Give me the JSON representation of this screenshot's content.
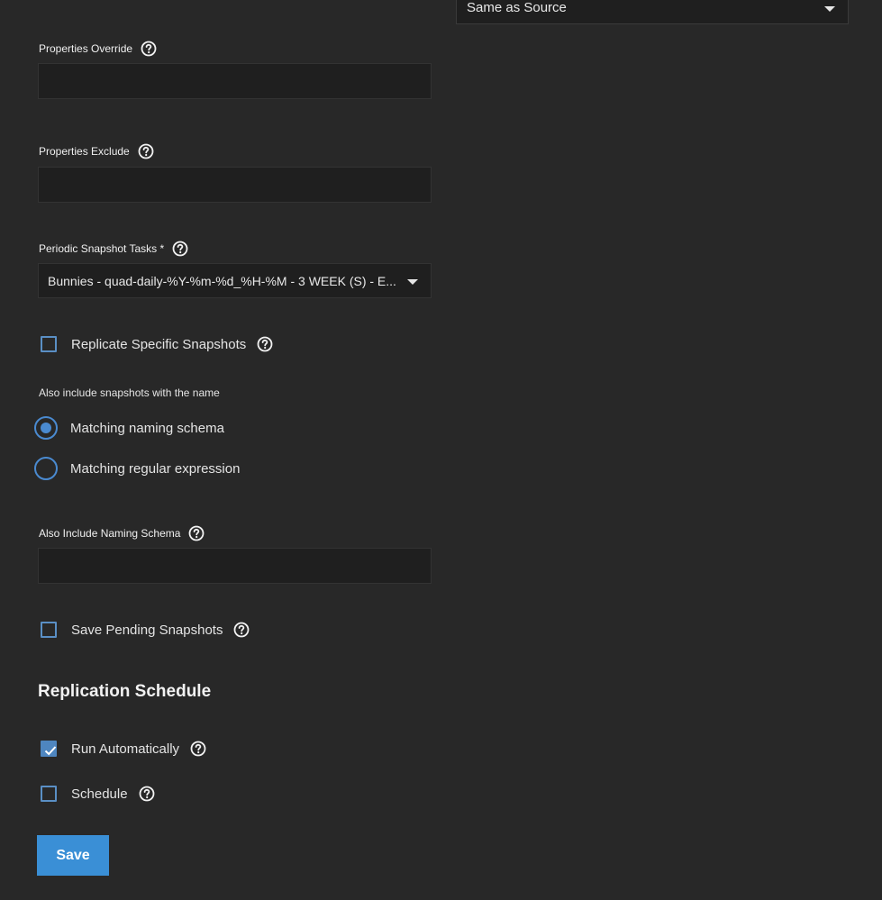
{
  "top_select": {
    "value": "Same as Source"
  },
  "properties_override": {
    "label": "Properties Override",
    "value": ""
  },
  "properties_exclude": {
    "label": "Properties Exclude",
    "value": ""
  },
  "periodic_snapshot_tasks": {
    "label": "Periodic Snapshot Tasks *",
    "value": "Bunnies - quad-daily-%Y-%m-%d_%H-%M - 3 WEEK (S) - E..."
  },
  "replicate_specific_snapshots": {
    "label": "Replicate Specific Snapshots",
    "checked": false
  },
  "also_include": {
    "label": "Also include snapshots with the name",
    "options": [
      {
        "label": "Matching naming schema",
        "selected": true
      },
      {
        "label": "Matching regular expression",
        "selected": false
      }
    ]
  },
  "also_include_naming_schema": {
    "label": "Also Include Naming Schema",
    "value": ""
  },
  "save_pending_snapshots": {
    "label": "Save Pending Snapshots",
    "checked": false
  },
  "replication_schedule": {
    "title": "Replication Schedule",
    "run_automatically": {
      "label": "Run Automatically",
      "checked": true
    },
    "schedule": {
      "label": "Schedule",
      "checked": false
    }
  },
  "save_button": {
    "label": "Save"
  },
  "colors": {
    "background": "#282828",
    "input_background": "#1f1f1f",
    "accent": "#3a8fd6",
    "checkbox_border": "#5a8fc5",
    "radio": "#4a8ad0"
  }
}
